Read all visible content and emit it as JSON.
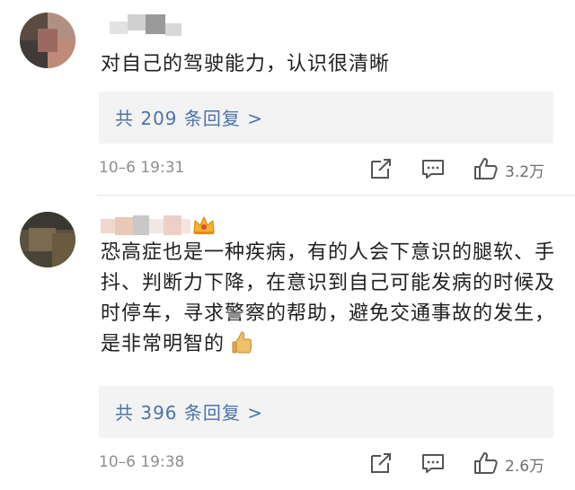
{
  "comments": [
    {
      "content": "对自己的驾驶能力，认识很清晰",
      "replies_label": "共 209 条回复 >",
      "time": "10–6 19:31",
      "likes": "3.2万"
    },
    {
      "content": "恐高症也是一种疾病，有的人会下意识的腿软、手抖、判断力下降，在意识到自己可能发病的时候及时停车，寻求警察的帮助，避免交通事故的发生，是非常明智的",
      "replies_label": "共 396 条回复 >",
      "time": "10–6 19:38",
      "likes": "2.6万"
    }
  ],
  "icons": {
    "share": "share-icon",
    "comment": "comment-icon",
    "like": "thumbs-up-icon",
    "crown": "crown-icon",
    "emoji": "thumbs-up-emoji"
  },
  "colors": {
    "reply_link": "#4a74a8",
    "meta_text": "#8e8e8e",
    "reply_bg": "#f3f3f4"
  }
}
